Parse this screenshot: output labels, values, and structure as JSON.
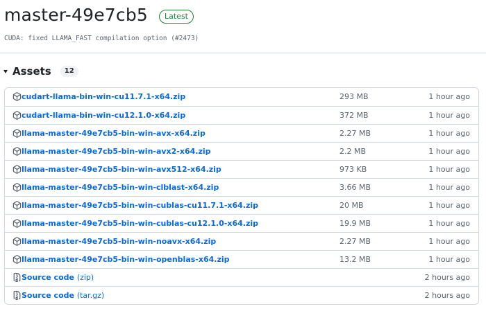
{
  "release": {
    "title": "master-49e7cb5",
    "badge": "Latest",
    "commit_message": "CUDA: fixed LLAMA_FAST compilation option (#2473)"
  },
  "assets": {
    "title": "Assets",
    "count": "12",
    "items": [
      {
        "name": "cudart-llama-bin-win-cu11.7.1-x64.zip",
        "size": "293 MB",
        "time": "1 hour ago",
        "icon": "package-icon"
      },
      {
        "name": "cudart-llama-bin-win-cu12.1.0-x64.zip",
        "size": "372 MB",
        "time": "1 hour ago",
        "icon": "package-icon"
      },
      {
        "name": "llama-master-49e7cb5-bin-win-avx-x64.zip",
        "size": "2.27 MB",
        "time": "1 hour ago",
        "icon": "package-icon"
      },
      {
        "name": "llama-master-49e7cb5-bin-win-avx2-x64.zip",
        "size": "2.2 MB",
        "time": "1 hour ago",
        "icon": "package-icon"
      },
      {
        "name": "llama-master-49e7cb5-bin-win-avx512-x64.zip",
        "size": "973 KB",
        "time": "1 hour ago",
        "icon": "package-icon"
      },
      {
        "name": "llama-master-49e7cb5-bin-win-clblast-x64.zip",
        "size": "3.66 MB",
        "time": "1 hour ago",
        "icon": "package-icon"
      },
      {
        "name": "llama-master-49e7cb5-bin-win-cublas-cu11.7.1-x64.zip",
        "size": "20 MB",
        "time": "1 hour ago",
        "icon": "package-icon"
      },
      {
        "name": "llama-master-49e7cb5-bin-win-cublas-cu12.1.0-x64.zip",
        "size": "19.9 MB",
        "time": "1 hour ago",
        "icon": "package-icon"
      },
      {
        "name": "llama-master-49e7cb5-bin-win-noavx-x64.zip",
        "size": "2.27 MB",
        "time": "1 hour ago",
        "icon": "package-icon"
      },
      {
        "name": "llama-master-49e7cb5-bin-win-openblas-x64.zip",
        "size": "13.2 MB",
        "time": "1 hour ago",
        "icon": "package-icon"
      },
      {
        "name": "Source code",
        "suffix": "(zip)",
        "size": "",
        "time": "2 hours ago",
        "icon": "file-zip-icon"
      },
      {
        "name": "Source code",
        "suffix": "(tar.gz)",
        "size": "",
        "time": "2 hours ago",
        "icon": "file-zip-icon"
      }
    ]
  },
  "colors": {
    "link": "#0969da",
    "muted": "#59636e",
    "border": "#d1d9e0",
    "latest_badge": "#1a7f37"
  }
}
